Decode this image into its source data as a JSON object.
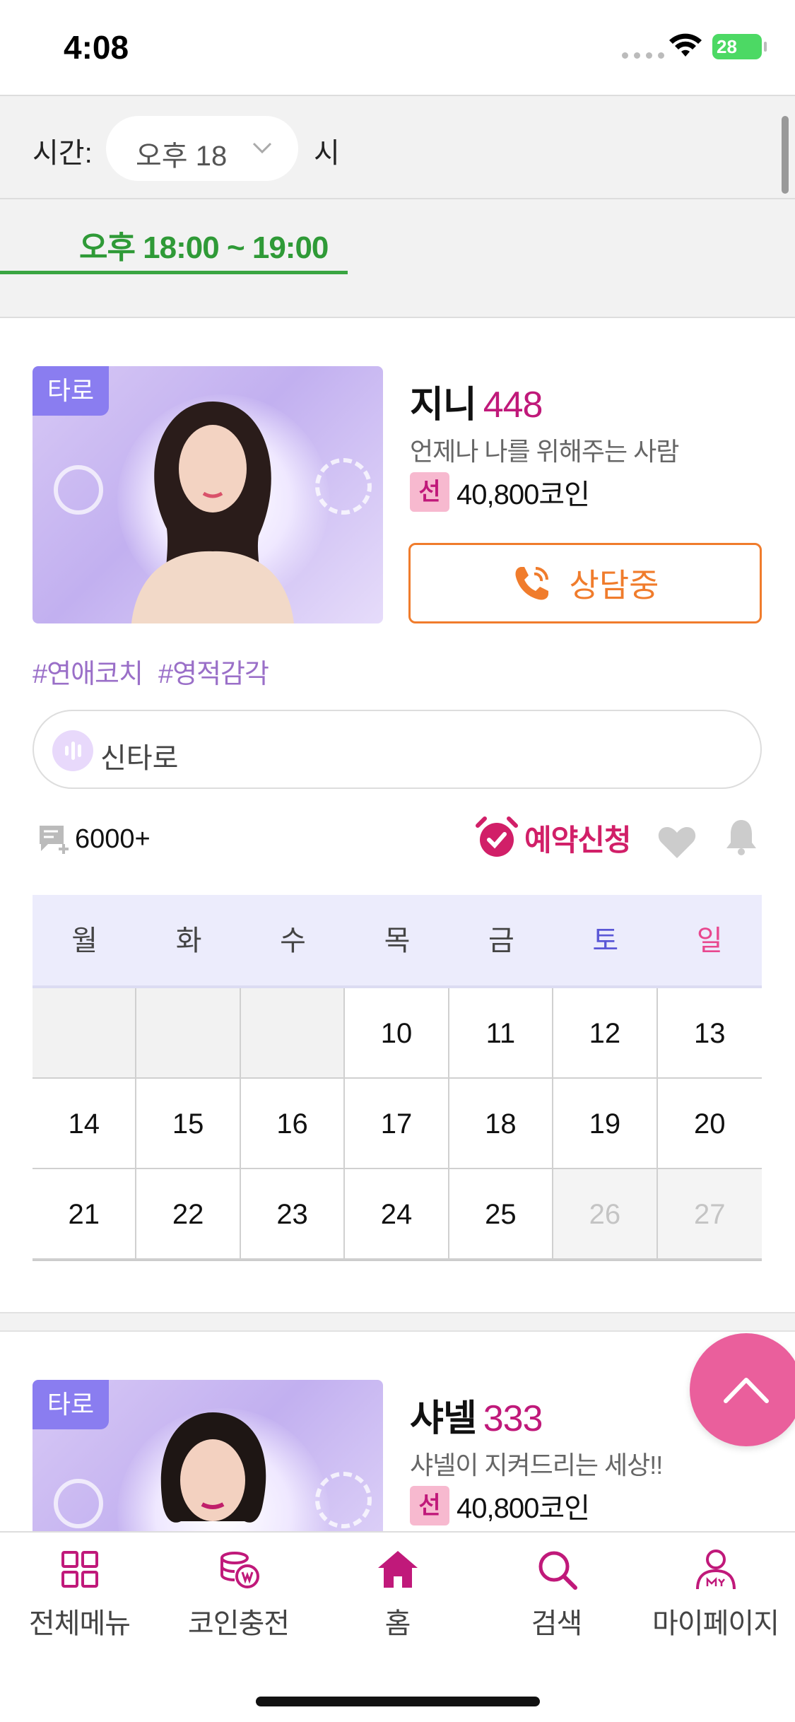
{
  "status_bar": {
    "time": "4:08",
    "battery": "28"
  },
  "time_filter": {
    "label": "시간:",
    "selected": "오후 18",
    "unit": "시"
  },
  "tabs": [
    {
      "label": "오후 18:00 ~ 19:00",
      "active": true
    }
  ],
  "counselors": [
    {
      "category": "타로",
      "name": "지니",
      "number": "448",
      "description": "언제나 나를 위해주는 사람",
      "price_badge": "선",
      "price": "40,800코인",
      "status_button": "상담중",
      "tags": [
        "#연애코치",
        "#영적감각"
      ],
      "voice_label": "신타로",
      "review_count": "6000+",
      "reserve_label": "예약신청",
      "calendar": {
        "weekdays": [
          "월",
          "화",
          "수",
          "목",
          "금",
          "토",
          "일"
        ],
        "rows": [
          [
            "",
            "",
            "",
            "10",
            "11",
            "12",
            "13"
          ],
          [
            "14",
            "15",
            "16",
            "17",
            "18",
            "19",
            "20"
          ],
          [
            "21",
            "22",
            "23",
            "24",
            "25",
            "26",
            "27"
          ]
        ],
        "unavailable": [
          "26",
          "27"
        ]
      }
    },
    {
      "category": "타로",
      "name": "샤넬",
      "number": "333",
      "description": "샤넬이 지켜드리는 세상!!",
      "price_badge": "선",
      "price": "40,800코인"
    }
  ],
  "bottom_nav": [
    {
      "label": "전체메뉴",
      "icon": "grid-icon"
    },
    {
      "label": "코인충전",
      "icon": "coin-icon"
    },
    {
      "label": "홈",
      "icon": "home-icon"
    },
    {
      "label": "검색",
      "icon": "search-icon"
    },
    {
      "label": "마이페이지",
      "icon": "user-icon"
    }
  ],
  "colors": {
    "accent_green": "#2f9a37",
    "brand_pink": "#c0197a",
    "call_orange": "#f07c2c",
    "fab_pink": "#ea5f9c",
    "badge_purple": "#8a7df0"
  }
}
